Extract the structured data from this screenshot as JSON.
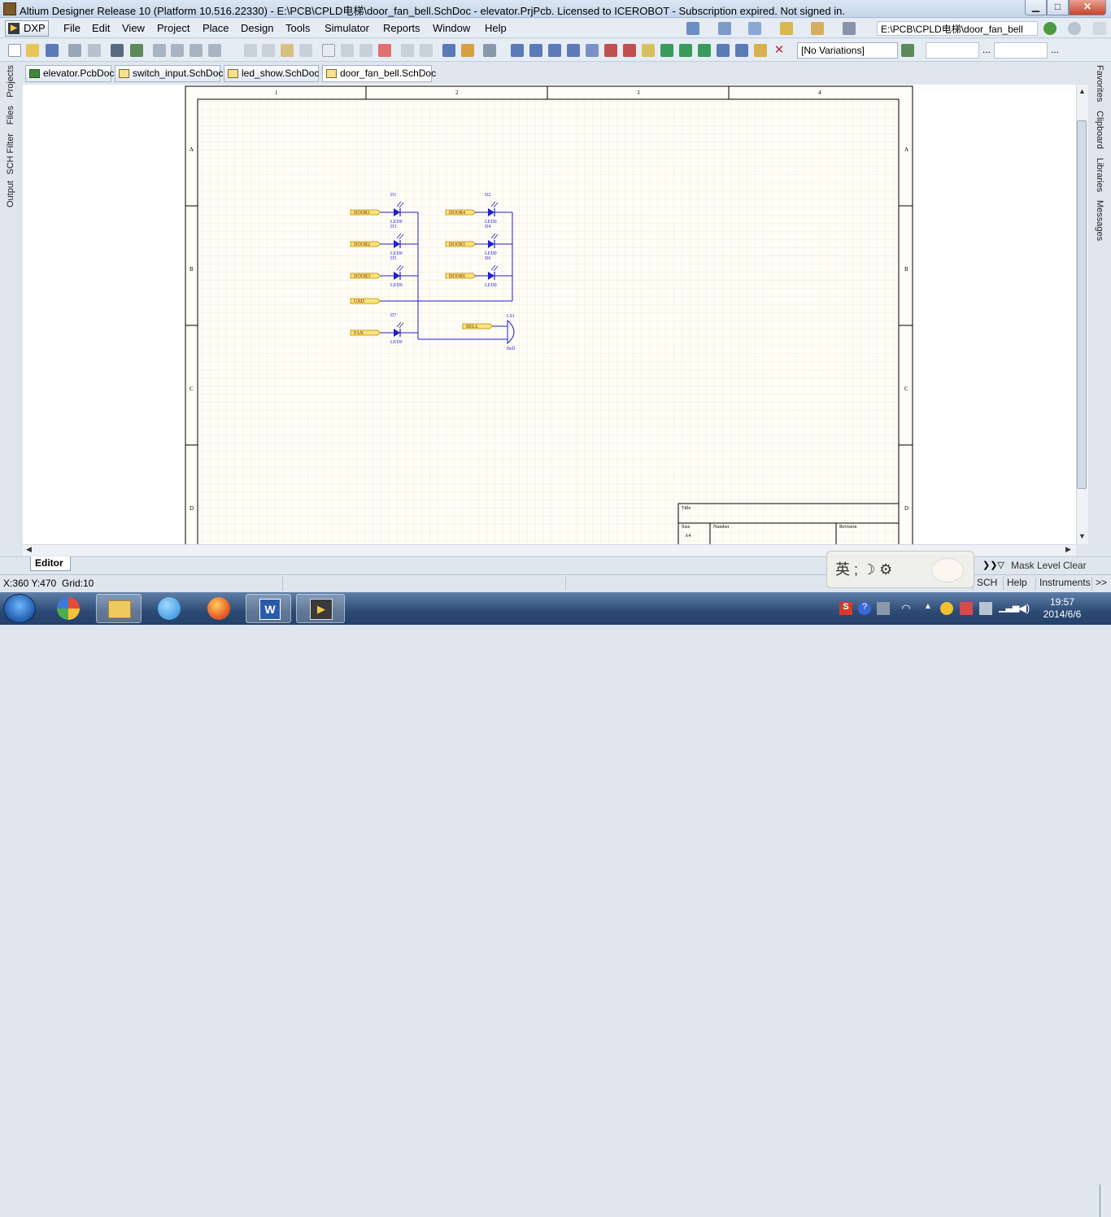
{
  "window": {
    "title": "Altium Designer Release 10 (Platform 10.516.22330) - E:\\PCB\\CPLD电梯\\door_fan_bell.SchDoc - elevator.PrjPcb. Licensed to ICEROBOT - Subscription expired. Not signed in.",
    "min_label": "▁",
    "max_label": "□",
    "close_label": "✕"
  },
  "menu": {
    "dxp": "DXP",
    "items": [
      "File",
      "Edit",
      "View",
      "Project",
      "Place",
      "Design",
      "Tools",
      "Simulator",
      "Reports",
      "Window",
      "Help"
    ],
    "path": "E:\\PCB\\CPLD电梯\\door_fan_bell"
  },
  "toolbar": {
    "variations": "[No Variations]",
    "ellipsis": "..."
  },
  "tabs": [
    {
      "label": "elevator.PcbDoc",
      "type": "pcb"
    },
    {
      "label": "switch_input.SchDoc",
      "type": "sch"
    },
    {
      "label": "led_show.SchDoc",
      "type": "sch"
    },
    {
      "label": "door_fan_bell.SchDoc",
      "type": "sch"
    }
  ],
  "left_panels": [
    "Projects",
    "Files",
    "SCH Filter",
    "Output"
  ],
  "right_panels": [
    "Favorites",
    "Clipboard",
    "Libraries",
    "Messages"
  ],
  "sheet": {
    "columns": [
      "1",
      "2",
      "3",
      "4"
    ],
    "rows": [
      "A",
      "B",
      "C",
      "D"
    ],
    "title_block": {
      "title": "Title",
      "size": "Size",
      "size_value": "A4",
      "number": "Number",
      "revision": "Revision"
    },
    "leds": [
      {
        "ref": "D1",
        "value": "LED0",
        "net": "DOOR1"
      },
      {
        "ref": "D3",
        "value": "LED0",
        "net": "DOOR2"
      },
      {
        "ref": "D5",
        "value": "LED0",
        "net": "DOOR3"
      },
      {
        "ref": "D2",
        "value": "LED0",
        "net": "DOOR4"
      },
      {
        "ref": "D4",
        "value": "LED0",
        "net": "DOOR5"
      },
      {
        "ref": "D6",
        "value": "LED0",
        "net": "DOOR6"
      },
      {
        "ref": "D7",
        "value": "LED0",
        "net": "FAN"
      }
    ],
    "gnd_net": "GND",
    "bell": {
      "ref": "LS1",
      "value": "Bell",
      "net": "BELL"
    }
  },
  "bottom": {
    "editor_tab": "Editor",
    "mask_level": "Mask Level",
    "clear": "Clear"
  },
  "status": {
    "coords": "X:360 Y:470",
    "grid": "Grid:10",
    "sch": "SCH",
    "help": "Help",
    "instruments": "Instruments",
    "more": ">>"
  },
  "ime": {
    "text": "英 ; ☽ ⚙"
  },
  "taskbar": {
    "time": "19:57",
    "date": "2014/6/6"
  },
  "colors": {
    "wire": "#1f1fd0",
    "netlabel_fill": "#ffe37a",
    "netlabel_border": "#b08a00",
    "sheet_border": "#000000",
    "grid": "#f0eadc"
  }
}
